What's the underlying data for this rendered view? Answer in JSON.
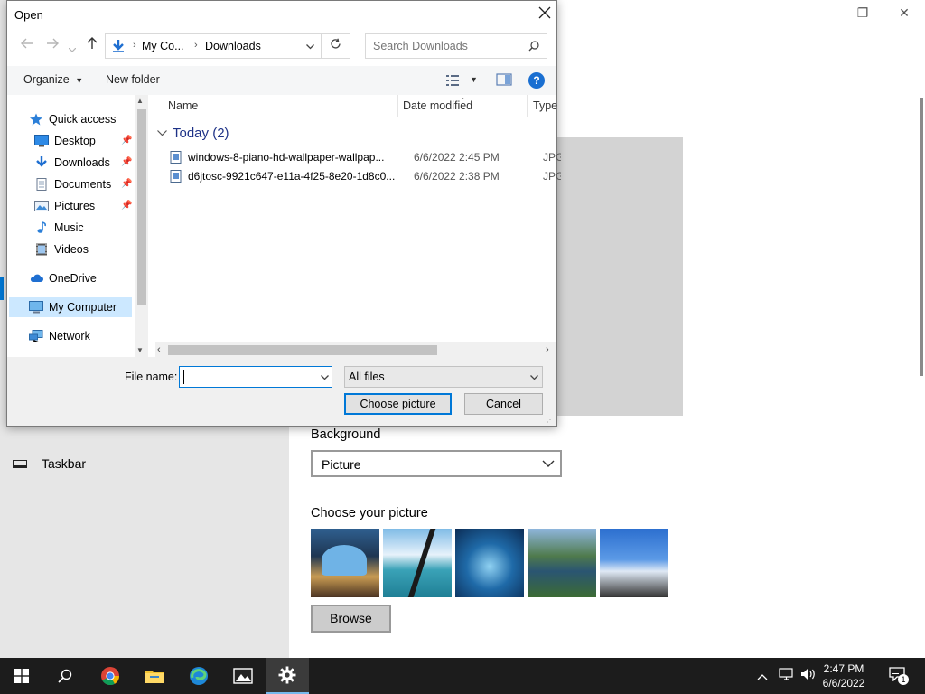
{
  "settings": {
    "taskbar_label": "Taskbar",
    "background_heading": "Background",
    "background_value": "Picture",
    "choose_heading": "Choose your picture",
    "browse_label": "Browse",
    "window_minimize": "—",
    "window_maximize": "❐",
    "window_close": "✕"
  },
  "dialog": {
    "title": "Open",
    "address": {
      "segments": [
        "My Co...",
        "Downloads"
      ]
    },
    "search_placeholder": "Search Downloads",
    "toolbar": {
      "organize": "Organize",
      "new_folder": "New folder"
    },
    "nav": [
      {
        "label": "Quick access",
        "icon": "star-icon",
        "pinned": false
      },
      {
        "label": "Desktop",
        "icon": "desktop-icon",
        "pinned": true
      },
      {
        "label": "Downloads",
        "icon": "download-arrow-icon",
        "pinned": true
      },
      {
        "label": "Documents",
        "icon": "document-icon",
        "pinned": true
      },
      {
        "label": "Pictures",
        "icon": "pictures-icon",
        "pinned": true
      },
      {
        "label": "Music",
        "icon": "music-note-icon",
        "pinned": false
      },
      {
        "label": "Videos",
        "icon": "video-icon",
        "pinned": false
      },
      {
        "label": "OneDrive",
        "icon": "cloud-icon",
        "pinned": false
      },
      {
        "label": "My Computer",
        "icon": "computer-icon",
        "pinned": false
      },
      {
        "label": "Network",
        "icon": "network-icon",
        "pinned": false
      }
    ],
    "columns": {
      "name": "Name",
      "date": "Date modified",
      "type": "Type"
    },
    "group_label": "Today (2)",
    "files": [
      {
        "name": "windows-8-piano-hd-wallpaper-wallpap...",
        "date": "6/6/2022 2:45 PM",
        "type": "JPG F"
      },
      {
        "name": "d6jtosc-9921c647-e11a-4f25-8e20-1d8c0...",
        "date": "6/6/2022 2:38 PM",
        "type": "JPG F"
      }
    ],
    "file_name_label": "File name:",
    "file_name_value": "",
    "filter_value": "All files",
    "choose_button": "Choose picture",
    "cancel_button": "Cancel"
  },
  "system_tray": {
    "time": "2:47 PM",
    "date": "6/6/2022",
    "notifications": "1"
  },
  "colors": {
    "accent": "#0078d7",
    "taskbar": "#1c1c1c"
  }
}
